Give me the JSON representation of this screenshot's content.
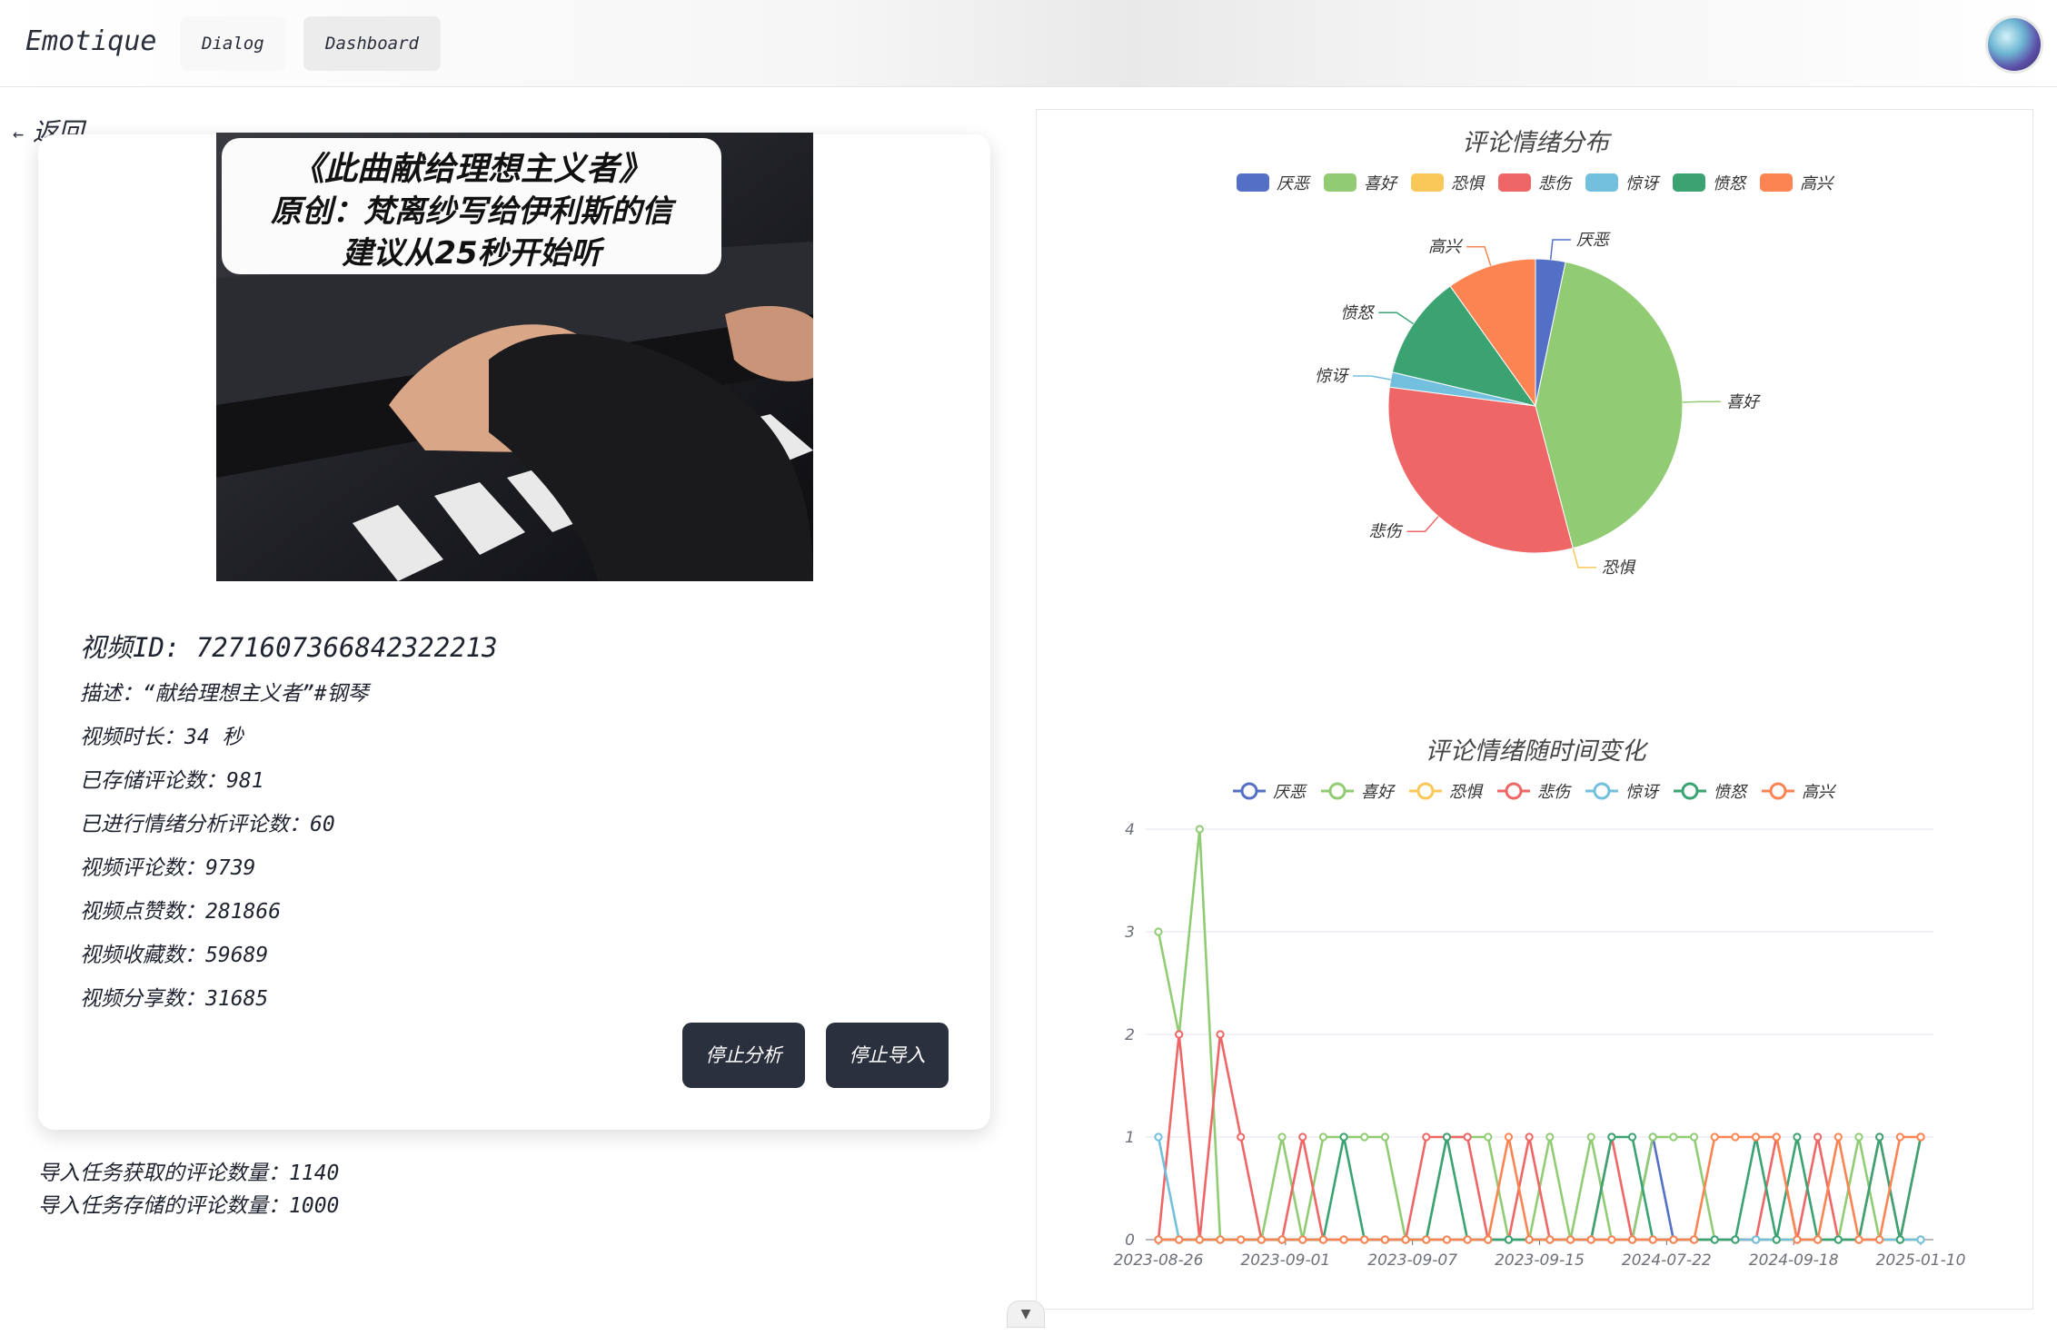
{
  "nav": {
    "brand": "Emotique",
    "tabs": [
      "Dialog",
      "Dashboard"
    ]
  },
  "back_label": "返回",
  "video": {
    "thumbnail_overlay": [
      "《此曲献给理想主义者》",
      "原创：梵离纱写给伊利斯的信",
      "建议从25秒开始听"
    ],
    "id_line": "视频ID: 7271607366842322213",
    "desc_line": "描述：“献给理想主义者”#钢琴",
    "duration_line": "视频时长：34 秒",
    "stored_comments_line": "已存储评论数：981",
    "analyzed_comments_line": "已进行情绪分析评论数：60",
    "comment_count_line": "视频评论数：9739",
    "like_count_line": "视频点赞数：281866",
    "favorite_count_line": "视频收藏数：59689",
    "share_count_line": "视频分享数：31685"
  },
  "buttons": {
    "stop_analysis": "停止分析",
    "stop_import": "停止导入"
  },
  "import_task": {
    "fetched_line": "导入任务获取的评论数量：1140",
    "stored_line": "导入任务存储的评论数量：1000"
  },
  "colors": {
    "厌恶": "#5470c6",
    "喜好": "#91cc75",
    "恐惧": "#fac858",
    "悲伤": "#ee6666",
    "惊讶": "#73c0de",
    "愤怒": "#3ba272",
    "高兴": "#fc8452"
  },
  "chart_data": [
    {
      "type": "pie",
      "title": "评论情绪分布",
      "legend": [
        "厌恶",
        "喜好",
        "恐惧",
        "悲伤",
        "惊讶",
        "愤怒",
        "高兴"
      ],
      "legend_position": "top",
      "slices": [
        {
          "name": "厌恶",
          "value": 2
        },
        {
          "name": "喜好",
          "value": 26
        },
        {
          "name": "恐惧",
          "value": 0
        },
        {
          "name": "悲伤",
          "value": 19
        },
        {
          "name": "惊讶",
          "value": 1
        },
        {
          "name": "愤怒",
          "value": 7
        },
        {
          "name": "高兴",
          "value": 6
        }
      ]
    },
    {
      "type": "line",
      "title": "评论情绪随时间变化",
      "legend": [
        "厌恶",
        "喜好",
        "恐惧",
        "悲伤",
        "惊讶",
        "愤怒",
        "高兴"
      ],
      "legend_position": "top",
      "x_ticks": [
        "2023-08-26",
        "2023-09-01",
        "2023-09-07",
        "2023-09-15",
        "2024-07-22",
        "2024-09-18",
        "2025-01-10"
      ],
      "y_ticks": [
        "0",
        "1",
        "2",
        "3",
        "4"
      ],
      "ylim": [
        0,
        4
      ],
      "grid": true,
      "n_points": 38,
      "series": [
        {
          "name": "厌恶",
          "values": [
            0,
            0,
            0,
            0,
            0,
            0,
            0,
            0,
            0,
            0,
            0,
            0,
            0,
            0,
            0,
            0,
            0,
            0,
            0,
            0,
            0,
            0,
            0,
            0,
            1,
            0,
            0,
            0,
            0,
            0,
            0,
            0,
            0,
            0,
            0,
            0,
            0,
            0
          ]
        },
        {
          "name": "喜好",
          "values": [
            3,
            2,
            4,
            0,
            0,
            0,
            1,
            0,
            1,
            1,
            1,
            1,
            0,
            0,
            1,
            1,
            1,
            0,
            0,
            1,
            0,
            1,
            0,
            0,
            1,
            1,
            1,
            0,
            0,
            0,
            0,
            0,
            0,
            0,
            1,
            0,
            0,
            0
          ]
        },
        {
          "name": "恐惧",
          "values": [
            0,
            0,
            0,
            0,
            0,
            0,
            0,
            0,
            0,
            0,
            0,
            0,
            0,
            0,
            0,
            0,
            0,
            0,
            0,
            0,
            0,
            0,
            0,
            0,
            0,
            0,
            0,
            0,
            0,
            0,
            0,
            0,
            0,
            0,
            0,
            0,
            0,
            0
          ]
        },
        {
          "name": "悲伤",
          "values": [
            0,
            2,
            0,
            2,
            1,
            0,
            0,
            1,
            0,
            0,
            0,
            0,
            0,
            1,
            1,
            1,
            0,
            0,
            1,
            0,
            0,
            0,
            1,
            0,
            0,
            0,
            0,
            0,
            0,
            0,
            1,
            0,
            1,
            0,
            0,
            1,
            0,
            1
          ]
        },
        {
          "name": "惊讶",
          "values": [
            1,
            0,
            0,
            0,
            0,
            0,
            0,
            0,
            0,
            0,
            0,
            0,
            0,
            0,
            0,
            0,
            0,
            0,
            0,
            0,
            0,
            0,
            0,
            0,
            0,
            0,
            0,
            0,
            0,
            0,
            0,
            0,
            0,
            0,
            0,
            0,
            0,
            0
          ]
        },
        {
          "name": "愤怒",
          "values": [
            0,
            0,
            0,
            0,
            0,
            0,
            0,
            0,
            0,
            1,
            0,
            0,
            0,
            0,
            1,
            0,
            0,
            0,
            0,
            0,
            0,
            0,
            1,
            1,
            0,
            0,
            0,
            0,
            0,
            1,
            0,
            1,
            0,
            0,
            0,
            1,
            0,
            1
          ]
        },
        {
          "name": "高兴",
          "values": [
            0,
            0,
            0,
            0,
            0,
            0,
            0,
            0,
            0,
            0,
            0,
            0,
            0,
            0,
            0,
            0,
            0,
            1,
            0,
            0,
            0,
            0,
            0,
            0,
            0,
            0,
            0,
            1,
            1,
            1,
            1,
            0,
            0,
            1,
            0,
            0,
            1,
            1
          ]
        }
      ]
    }
  ]
}
